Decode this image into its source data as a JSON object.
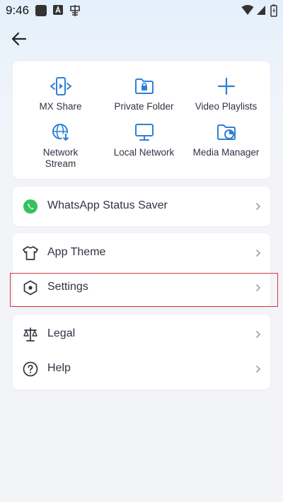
{
  "status_bar": {
    "time": "9:46"
  },
  "menu": {
    "tiles": [
      {
        "label": "MX Share",
        "icon": "mx-share-icon"
      },
      {
        "label": "Private Folder",
        "icon": "private-folder-icon"
      },
      {
        "label": "Video Playlists",
        "icon": "plus-icon"
      },
      {
        "label": "Network Stream",
        "icon": "network-stream-icon"
      },
      {
        "label": "Local Network",
        "icon": "local-network-icon"
      },
      {
        "label": "Media Manager",
        "icon": "media-manager-icon"
      }
    ],
    "whatsapp": {
      "label": "WhatsApp Status Saver",
      "icon": "whatsapp-icon"
    },
    "app_theme": {
      "label": "App Theme",
      "icon": "shirt-icon"
    },
    "settings": {
      "label": "Settings",
      "icon": "hexagon-icon"
    },
    "legal": {
      "label": "Legal",
      "icon": "scales-icon"
    },
    "help": {
      "label": "Help",
      "icon": "help-circle-icon"
    }
  },
  "colors": {
    "accent": "#2f80d8",
    "whatsapp": "#35c25a",
    "highlight": "#d9363e"
  }
}
